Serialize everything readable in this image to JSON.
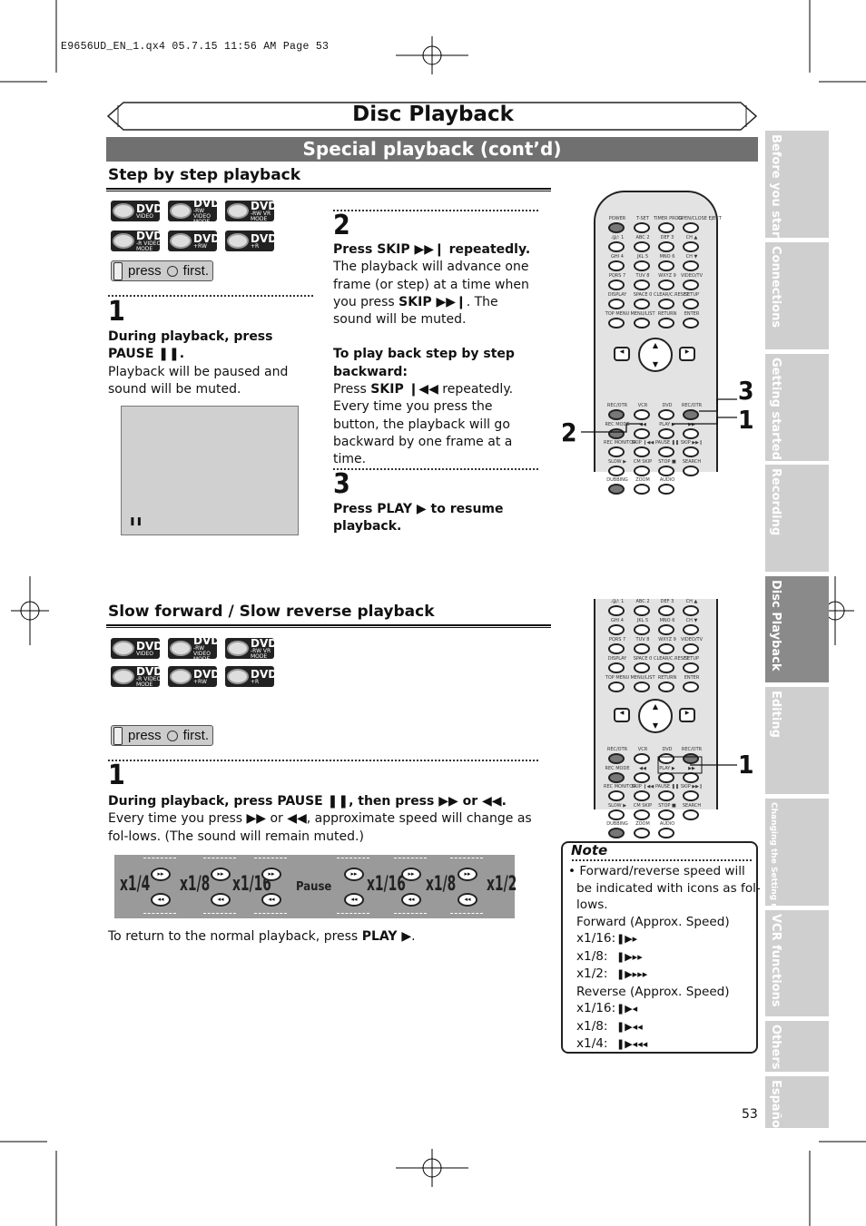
{
  "print_slug": "E9656UD_EN_1.qx4  05.7.15  11:56 AM  Page 53",
  "header": {
    "title": "Disc Playback",
    "subtitle": "Special playback (cont’d)"
  },
  "badges": [
    {
      "main": "DVD",
      "sub": "VIDEO"
    },
    {
      "main": "DVD",
      "sub": "-RW VIDEO MODE"
    },
    {
      "main": "DVD",
      "sub": "-RW VR MODE"
    },
    {
      "main": "DVD",
      "sub": "-R VIDEO MODE"
    },
    {
      "main": "DVD",
      "sub": "+RW"
    },
    {
      "main": "DVD",
      "sub": "+R"
    }
  ],
  "press_first": {
    "pre": "press",
    "post": "first.",
    "icon": "dvd-button-icon"
  },
  "step_section": {
    "title": "Step by step playback",
    "step1": {
      "num": "1",
      "bold1": "During playback, press",
      "bold2": "PAUSE ❚❚.",
      "text": "Playback will be paused and sound will be muted.",
      "screen_icon": "❚❚"
    },
    "step2": {
      "num": "2",
      "bold": "Press SKIP ▶▶❙ repeatedly.",
      "text1": "The playback will advance one frame (or step) at a time when you press ",
      "skip": "SKIP ▶▶❙",
      "text2": ". The sound will be muted.",
      "back_title": "To play back step by step backward:",
      "back1": "Press ",
      "back_skip": "SKIP ❙◀◀",
      "back2": " repeatedly.",
      "back3": "Every time you press the button, the playback will go backward by one frame at a time."
    },
    "step3": {
      "num": "3",
      "bold": "Press PLAY ▶ to resume playback."
    }
  },
  "slow_section": {
    "title": "Slow forward / Slow reverse playback",
    "step1": {
      "num": "1",
      "bold": "During playback, press PAUSE ❚❚, then press ▶▶ or ◀◀.",
      "text": "Every time you press ▶▶ or ◀◀, approximate speed will change as fol-lows. (The sound will remain muted.)"
    },
    "speeds": [
      "x1/4",
      "x1/8",
      "x1/16",
      "Pause",
      "x1/16",
      "x1/8",
      "x1/2"
    ],
    "return_text": "To return to the normal playback, press ",
    "return_bold": "PLAY ▶",
    "return_end": "."
  },
  "note": {
    "title": "Note",
    "bullet": "• Forward/reverse speed will be indicated with icons as fol-lows.",
    "forward_title": "Forward (Approx. Speed)",
    "forward": [
      {
        "speed": "x1/16:",
        "icon": "❚▶▸"
      },
      {
        "speed": "x1/8:",
        "icon": "❚▶▸▸"
      },
      {
        "speed": "x1/2:",
        "icon": "❚▶▸▸▸"
      }
    ],
    "reverse_title": "Reverse (Approx. Speed)",
    "reverse": [
      {
        "speed": "x1/16:",
        "icon": "❚▶◂"
      },
      {
        "speed": "x1/8:",
        "icon": "❚▶◂◂"
      },
      {
        "speed": "x1/4:",
        "icon": "❚▶◂◂◂"
      }
    ]
  },
  "remote": {
    "top_rows": [
      [
        "POWER",
        "T-SET",
        "TIMER PROG.",
        "OPEN/CLOSE EJECT"
      ],
      [
        ".@/: 1",
        "ABC 2",
        "DEF 3",
        "CH ▲"
      ],
      [
        "GHI 4",
        "JKL 5",
        "MNO 6",
        "CH ▼"
      ],
      [
        "PQRS 7",
        "TUV 8",
        "WXYZ 9",
        "VIDEO/TV"
      ],
      [
        "DISPLAY",
        "SPACE 0",
        "CLEAR/C.RESET",
        "SETUP"
      ],
      [
        "TOP MENU",
        "MENU/LIST",
        "RETURN",
        "ENTER"
      ]
    ],
    "bottom_rows": [
      [
        "REC/OTR",
        "VCR",
        "DVD",
        "REC/OTR"
      ],
      [
        "REC MODE",
        "◀◀",
        "PLAY ▶",
        "▶▶"
      ],
      [
        "REC MONITOR",
        "SKIP ❙◀◀",
        "PAUSE ❚❚",
        "SKIP ▶▶❙"
      ],
      [
        "SLOW ▶",
        "CM SKIP",
        "STOP ■",
        "SEARCH"
      ],
      [
        "DUBBING",
        "ZOOM",
        "AUDIO",
        ""
      ]
    ],
    "callouts_top": [
      "3",
      "1",
      "2"
    ],
    "callouts_bottom": [
      "1"
    ]
  },
  "side_tabs": [
    {
      "label": "Before you start",
      "active": false
    },
    {
      "label": "Connections",
      "active": false
    },
    {
      "label": "Getting started",
      "active": false
    },
    {
      "label": "Recording",
      "active": false
    },
    {
      "label": "Disc Playback",
      "active": true
    },
    {
      "label": "Editing",
      "active": false
    },
    {
      "label": "Changing the Setting menu",
      "active": false
    },
    {
      "label": "VCR functions",
      "active": false
    },
    {
      "label": "Others",
      "active": false
    },
    {
      "label": "Español",
      "active": false
    }
  ],
  "page_number": "53"
}
